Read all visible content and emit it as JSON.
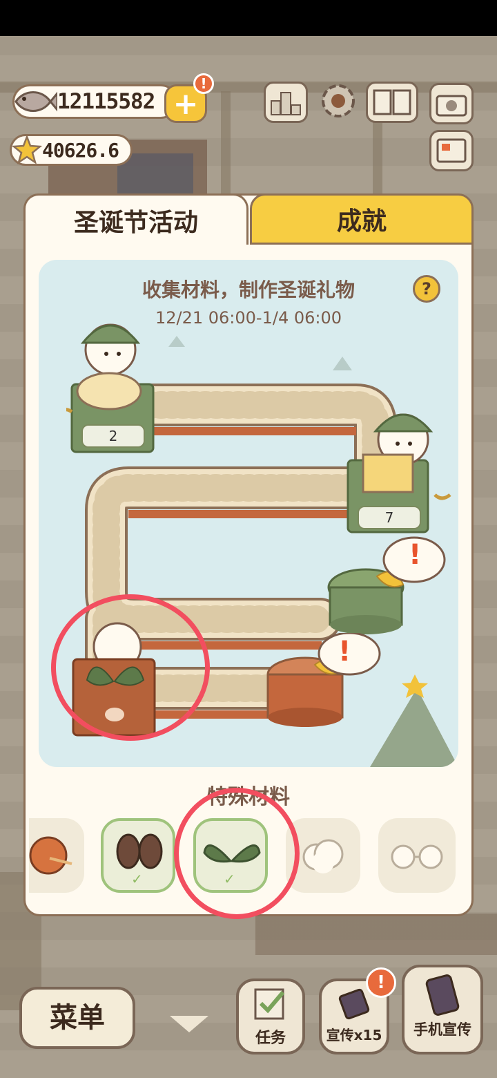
{
  "hud": {
    "fish_amount": "12115582",
    "star_amount": "40626.6",
    "plus_label": "+",
    "alert_mark": "!",
    "icons": [
      "ranking-icon",
      "settings-gear-icon",
      "recipe-book-icon",
      "camera-icon",
      "newspaper-icon"
    ]
  },
  "tabs": [
    {
      "label": "圣诞节活动",
      "active": true
    },
    {
      "label": "成就",
      "active": false
    }
  ],
  "event": {
    "title": "收集材料，制作圣诞礼物",
    "time": "12/21 06:00-1/4 06:00",
    "help_label": "?",
    "machines": [
      {
        "name": "yarn-spool-machine",
        "count": "2"
      },
      {
        "name": "box-machine",
        "count": "7"
      }
    ],
    "pot_alert": "!"
  },
  "materials": {
    "section_label": "特殊材料",
    "items": [
      {
        "icon": "yarn-ball-icon",
        "collected": false
      },
      {
        "icon": "mittens-icon",
        "collected": true
      },
      {
        "icon": "leaf-icon",
        "collected": true
      },
      {
        "icon": "cotton-icon",
        "collected": false
      },
      {
        "icon": "glasses-icon",
        "collected": false
      }
    ],
    "check_mark": "✓"
  },
  "bottom": {
    "menu_label": "菜单",
    "tasks_label": "任务",
    "promote_label": "宣传x15",
    "phone_promote_label": "手机宣传",
    "promote_alert": "!"
  },
  "colors": {
    "accent_yellow": "#f7cd42",
    "frame_brown": "#8c6f56",
    "panel_cream": "#fffaf0",
    "annotation_red": "#f24e5f",
    "event_bg": "#d9ecee"
  }
}
